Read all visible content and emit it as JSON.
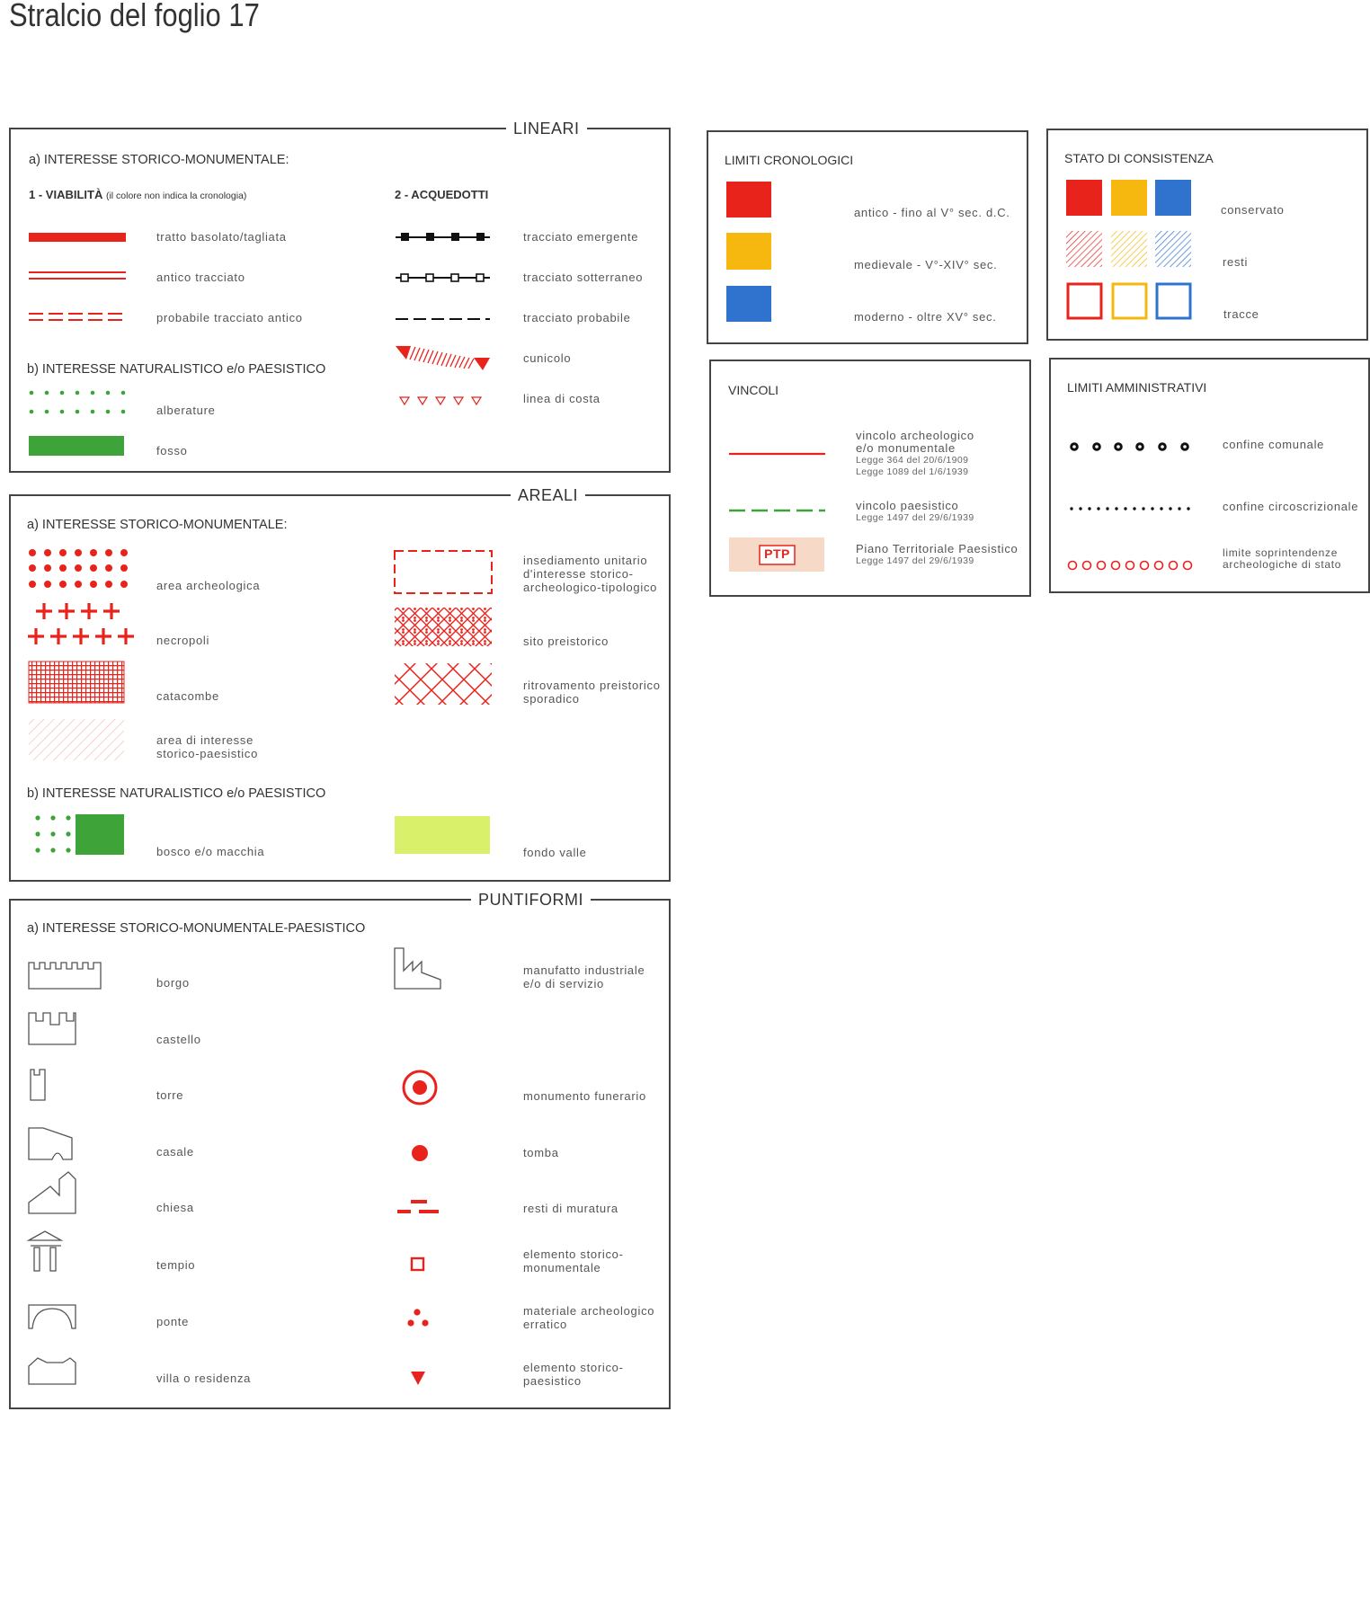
{
  "page_title": "Stralcio del foglio 17",
  "colors": {
    "red": "#e8231c",
    "yellow": "#f6b80f",
    "blue": "#2f73cf",
    "green": "#3ea43a",
    "light_green": "#d9f06a",
    "ptp_bg": "#f7d9c8"
  },
  "lineari": {
    "title": "LINEARI",
    "section_a": "a) INTERESSE STORICO-MONUMENTALE:",
    "viabilita_heading": "1 - VIABILITÀ",
    "viabilita_note": "(il colore non indica la cronologia)",
    "acquedotti_heading": "2 - ACQUEDOTTI",
    "items_left": [
      "tratto basolato/tagliata",
      "antico tracciato",
      "probabile tracciato antico"
    ],
    "items_right": [
      "tracciato emergente",
      "tracciato sotterraneo",
      "tracciato probabile",
      "cunicolo",
      "linea di costa"
    ],
    "section_b": "b) INTERESSE NATURALISTICO e/o PAESISTICO",
    "items_b": [
      "alberature",
      "fosso"
    ]
  },
  "areali": {
    "title": "AREALI",
    "section_a": "a) INTERESSE STORICO-MONUMENTALE:",
    "items_left": [
      "area archeologica",
      "necropoli",
      "catacombe",
      "area di interesse",
      "storico-paesistico"
    ],
    "items_right": [
      "insediamento unitario",
      "d'interesse storico-",
      "archeologico-tipologico",
      "sito preistorico",
      "ritrovamento preistorico",
      "sporadico"
    ],
    "section_b": "b) INTERESSE NATURALISTICO e/o PAESISTICO",
    "items_b": [
      "bosco e/o macchia",
      "fondo valle"
    ]
  },
  "puntiformi": {
    "title": "PUNTIFORMI",
    "section_a": "a) INTERESSE STORICO-MONUMENTALE-PAESISTICO",
    "items_left": [
      "borgo",
      "castello",
      "torre",
      "casale",
      "chiesa",
      "tempio",
      "ponte",
      "villa o residenza"
    ],
    "items_right": [
      "manufatto industriale",
      "e/o di servizio",
      "monumento funerario",
      "tomba",
      "resti di muratura",
      "elemento storico-",
      "monumentale",
      "materiale archeologico",
      "erratico",
      "elemento storico-",
      "paesistico"
    ],
    "icons_left": [
      "borgo-icon",
      "castello-icon",
      "torre-icon",
      "casale-icon",
      "chiesa-icon",
      "tempio-icon",
      "ponte-icon",
      "villa-icon"
    ],
    "icons_right": [
      "manufatto-industriale-icon",
      "monumento-funerario-icon",
      "tomba-icon",
      "resti-muratura-icon",
      "elemento-storico-monumentale-icon",
      "materiale-archeologico-icon",
      "elemento-storico-paesistico-icon"
    ]
  },
  "limiti_cronologici": {
    "title": "LIMITI CRONOLOGICI",
    "items": [
      "antico - fino al V° sec. d.C.",
      "medievale - V°-XIV° sec.",
      "moderno - oltre XV° sec."
    ]
  },
  "stato_consistenza": {
    "title": "STATO DI CONSISTENZA",
    "items": [
      "conservato",
      "resti",
      "tracce"
    ]
  },
  "vincoli": {
    "title": "VINCOLI",
    "v1_l1": "vincolo archeologico",
    "v1_l2": "e/o monumentale",
    "v1_law1": "Legge 364 del 20/6/1909",
    "v1_law2": "Legge 1089 del 1/6/1939",
    "v2": "vincolo paesistico",
    "v2_law": "Legge 1497 del 29/6/1939",
    "v3": "Piano Territoriale Paesistico",
    "v3_law": "Legge 1497 del 29/6/1939",
    "ptp_badge": "PTP"
  },
  "limiti_amministrativi": {
    "title": "LIMITI AMMINISTRATIVI",
    "items": [
      "confine comunale",
      "confine circoscrizionale",
      "limite soprintendenze",
      "archeologiche di stato"
    ]
  }
}
